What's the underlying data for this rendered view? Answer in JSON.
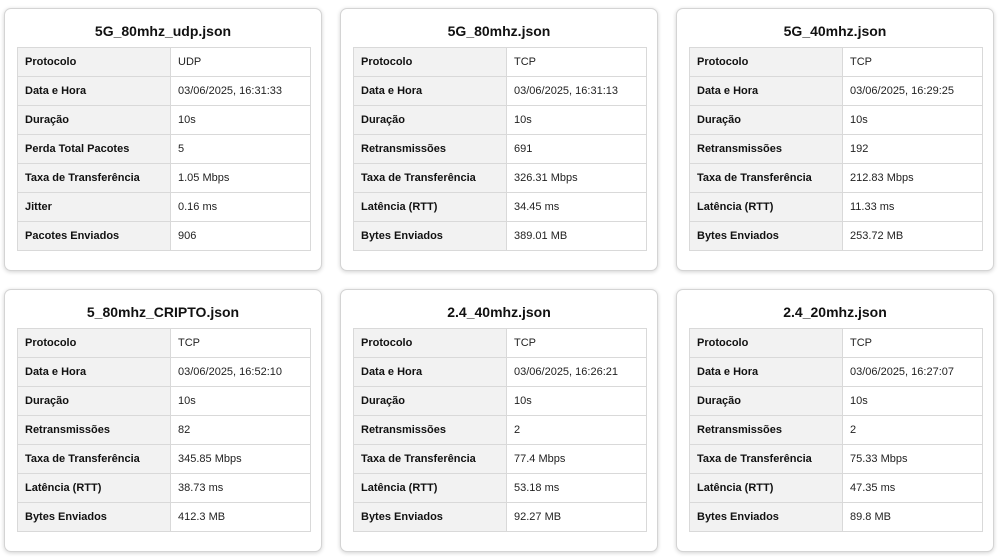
{
  "cards": [
    {
      "title": "5G_80mhz_udp.json",
      "rows": [
        {
          "label": "Protocolo",
          "value": "UDP"
        },
        {
          "label": "Data e Hora",
          "value": "03/06/2025, 16:31:33"
        },
        {
          "label": "Duração",
          "value": "10s"
        },
        {
          "label": "Perda Total Pacotes",
          "value": "5"
        },
        {
          "label": "Taxa de Transferência",
          "value": "1.05 Mbps"
        },
        {
          "label": "Jitter",
          "value": "0.16 ms"
        },
        {
          "label": "Pacotes Enviados",
          "value": "906"
        }
      ]
    },
    {
      "title": "5G_80mhz.json",
      "rows": [
        {
          "label": "Protocolo",
          "value": "TCP"
        },
        {
          "label": "Data e Hora",
          "value": "03/06/2025, 16:31:13"
        },
        {
          "label": "Duração",
          "value": "10s"
        },
        {
          "label": "Retransmissões",
          "value": "691"
        },
        {
          "label": "Taxa de Transferência",
          "value": "326.31 Mbps"
        },
        {
          "label": "Latência (RTT)",
          "value": "34.45 ms"
        },
        {
          "label": "Bytes Enviados",
          "value": "389.01 MB"
        }
      ]
    },
    {
      "title": "5G_40mhz.json",
      "rows": [
        {
          "label": "Protocolo",
          "value": "TCP"
        },
        {
          "label": "Data e Hora",
          "value": "03/06/2025, 16:29:25"
        },
        {
          "label": "Duração",
          "value": "10s"
        },
        {
          "label": "Retransmissões",
          "value": "192"
        },
        {
          "label": "Taxa de Transferência",
          "value": "212.83 Mbps"
        },
        {
          "label": "Latência (RTT)",
          "value": "11.33 ms"
        },
        {
          "label": "Bytes Enviados",
          "value": "253.72 MB"
        }
      ]
    },
    {
      "title": "5_80mhz_CRIPTO.json",
      "rows": [
        {
          "label": "Protocolo",
          "value": "TCP"
        },
        {
          "label": "Data e Hora",
          "value": "03/06/2025, 16:52:10"
        },
        {
          "label": "Duração",
          "value": "10s"
        },
        {
          "label": "Retransmissões",
          "value": "82"
        },
        {
          "label": "Taxa de Transferência",
          "value": "345.85 Mbps"
        },
        {
          "label": "Latência (RTT)",
          "value": "38.73 ms"
        },
        {
          "label": "Bytes Enviados",
          "value": "412.3 MB"
        }
      ]
    },
    {
      "title": "2.4_40mhz.json",
      "rows": [
        {
          "label": "Protocolo",
          "value": "TCP"
        },
        {
          "label": "Data e Hora",
          "value": "03/06/2025, 16:26:21"
        },
        {
          "label": "Duração",
          "value": "10s"
        },
        {
          "label": "Retransmissões",
          "value": "2"
        },
        {
          "label": "Taxa de Transferência",
          "value": "77.4 Mbps"
        },
        {
          "label": "Latência (RTT)",
          "value": "53.18 ms"
        },
        {
          "label": "Bytes Enviados",
          "value": "92.27 MB"
        }
      ]
    },
    {
      "title": "2.4_20mhz.json",
      "rows": [
        {
          "label": "Protocolo",
          "value": "TCP"
        },
        {
          "label": "Data e Hora",
          "value": "03/06/2025, 16:27:07"
        },
        {
          "label": "Duração",
          "value": "10s"
        },
        {
          "label": "Retransmissões",
          "value": "2"
        },
        {
          "label": "Taxa de Transferência",
          "value": "75.33 Mbps"
        },
        {
          "label": "Latência (RTT)",
          "value": "47.35 ms"
        },
        {
          "label": "Bytes Enviados",
          "value": "89.8 MB"
        }
      ]
    }
  ]
}
